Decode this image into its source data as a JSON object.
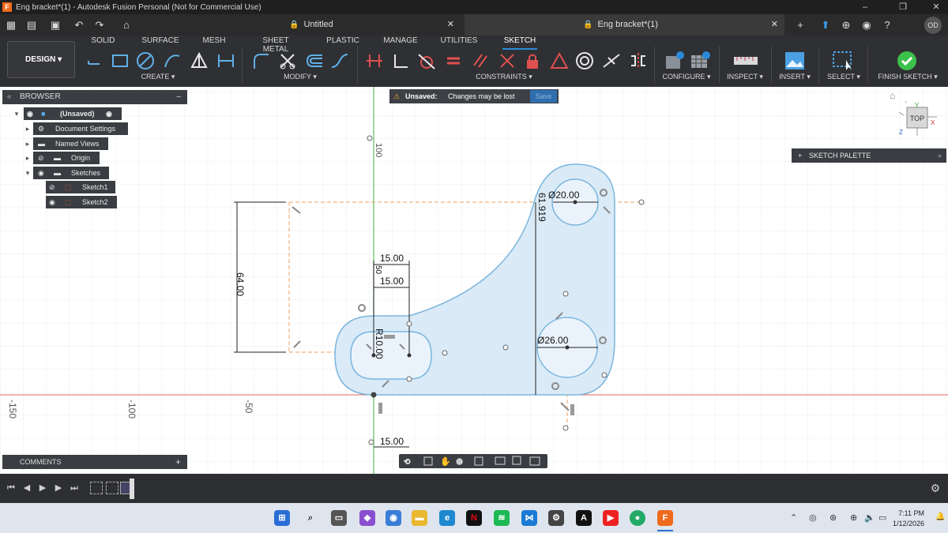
{
  "window": {
    "title": "Eng bracket*(1) - Autodesk Fusion Personal (Not for Commercial Use)",
    "app_badge": "F"
  },
  "tabs": [
    {
      "label": "Untitled"
    },
    {
      "label": "Eng bracket*(1)"
    }
  ],
  "user": {
    "initials": "OD"
  },
  "ribbon": {
    "menu_tabs": [
      "SOLID",
      "SURFACE",
      "MESH",
      "SHEET METAL",
      "PLASTIC",
      "MANAGE",
      "UTILITIES",
      "SKETCH"
    ],
    "active_tab": "SKETCH",
    "workspace": "DESIGN",
    "groups": {
      "create": "CREATE",
      "modify": "MODIFY",
      "constraints": "CONSTRAINTS",
      "configure": "CONFIGURE",
      "inspect": "INSPECT",
      "insert": "INSERT",
      "select": "SELECT",
      "finish": "FINISH SKETCH"
    }
  },
  "browser": {
    "title": "BROWSER",
    "root": "(Unsaved)",
    "items": [
      {
        "label": "Document Settings"
      },
      {
        "label": "Named Views"
      },
      {
        "label": "Origin"
      },
      {
        "label": "Sketches"
      },
      {
        "label": "Sketch1"
      },
      {
        "label": "Sketch2"
      }
    ]
  },
  "notice": {
    "label": "Unsaved:",
    "message": "Changes may be lost",
    "save": "Save"
  },
  "sketch_palette": {
    "title": "SKETCH PALETTE"
  },
  "viewcube": {
    "face": "TOP",
    "axes": [
      "X",
      "Y",
      "Z"
    ]
  },
  "comments": {
    "title": "COMMENTS"
  },
  "dimensions": {
    "height": "64.00",
    "top_width_1": "15.00",
    "top_width_2": "15.00",
    "small_v": "50",
    "radius": "R10.00",
    "bottom_width": "15.00",
    "dia_top": "Ø20.00",
    "dia_bottom": "Ø26.00",
    "vertical_offset": "61.919",
    "ruler_100_vertical": "100"
  },
  "rulers": [
    "-150",
    "-100",
    "-50"
  ],
  "taskbar": {
    "time": "7:11 PM",
    "date": "1/12/2026"
  }
}
